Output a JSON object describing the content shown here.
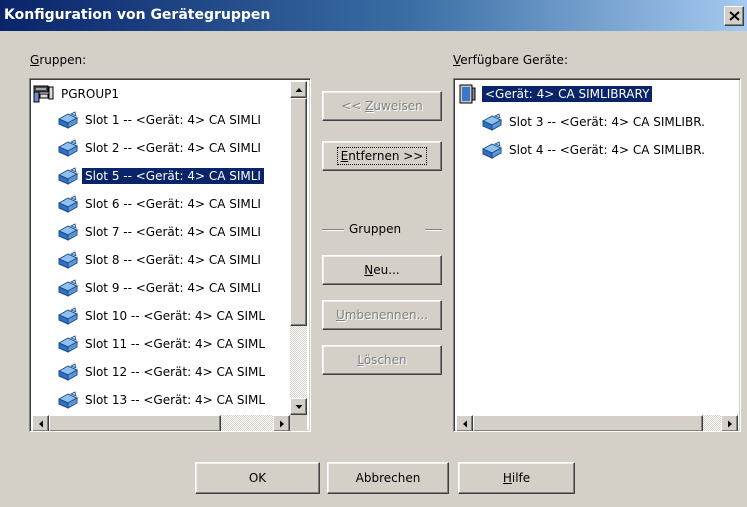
{
  "window": {
    "title": "Konfiguration von Gerätegruppen",
    "close_label": "×"
  },
  "left": {
    "label_prefix": "",
    "label_mnemonic": "G",
    "label_rest": "ruppen:",
    "group_name": "PGROUP1",
    "items": [
      {
        "label": "Slot 1 -- <Gerät: 4> CA SIMLI",
        "selected": false
      },
      {
        "label": "Slot 2 -- <Gerät: 4> CA SIMLI",
        "selected": false
      },
      {
        "label": "Slot 5 -- <Gerät: 4> CA SIMLI",
        "selected": true
      },
      {
        "label": "Slot 6 -- <Gerät: 4> CA SIMLI",
        "selected": false
      },
      {
        "label": "Slot 7 -- <Gerät: 4> CA SIMLI",
        "selected": false
      },
      {
        "label": "Slot 8 -- <Gerät: 4> CA SIMLI",
        "selected": false
      },
      {
        "label": "Slot 9 -- <Gerät: 4> CA SIMLI",
        "selected": false
      },
      {
        "label": "Slot 10 -- <Gerät: 4> CA SIML",
        "selected": false
      },
      {
        "label": "Slot 11 -- <Gerät: 4> CA SIML",
        "selected": false
      },
      {
        "label": "Slot 12 -- <Gerät: 4> CA SIML",
        "selected": false
      },
      {
        "label": "Slot 13 -- <Gerät: 4> CA SIML",
        "selected": false
      }
    ]
  },
  "right": {
    "label_prefix": "",
    "label_mnemonic": "V",
    "label_rest": "erfügbare Geräte:",
    "library": "<Gerät: 4> CA SIMLIBRARY",
    "items": [
      {
        "label": "Slot 3 -- <Gerät: 4> CA SIMLIBR."
      },
      {
        "label": "Slot 4 -- <Gerät: 4> CA SIMLIBR."
      }
    ]
  },
  "middle": {
    "assign": {
      "prefix": "<< ",
      "mnemonic": "Z",
      "rest": "uweisen",
      "disabled": true
    },
    "remove": {
      "prefix": "",
      "mnemonic": "E",
      "rest": "ntfernen >>",
      "disabled": false
    },
    "groups_label": "Gruppen",
    "new": {
      "prefix": "",
      "mnemonic": "N",
      "rest": "eu...",
      "disabled": false
    },
    "rename": {
      "prefix": "",
      "mnemonic": "U",
      "rest": "mbenennen...",
      "disabled": true
    },
    "delete": {
      "prefix": "",
      "mnemonic": "L",
      "rest": "öschen",
      "disabled": true
    }
  },
  "footer": {
    "ok": "OK",
    "cancel": "Abbrechen",
    "help": {
      "mnemonic": "H",
      "rest": "ilfe"
    }
  },
  "colors": {
    "selection": "#0a246a",
    "face": "#d4d0c8",
    "icon_blue": "#3a78c8"
  },
  "icons": {
    "group": "group-computer-icon",
    "slot": "tape-slot-icon",
    "library": "tape-library-icon"
  }
}
